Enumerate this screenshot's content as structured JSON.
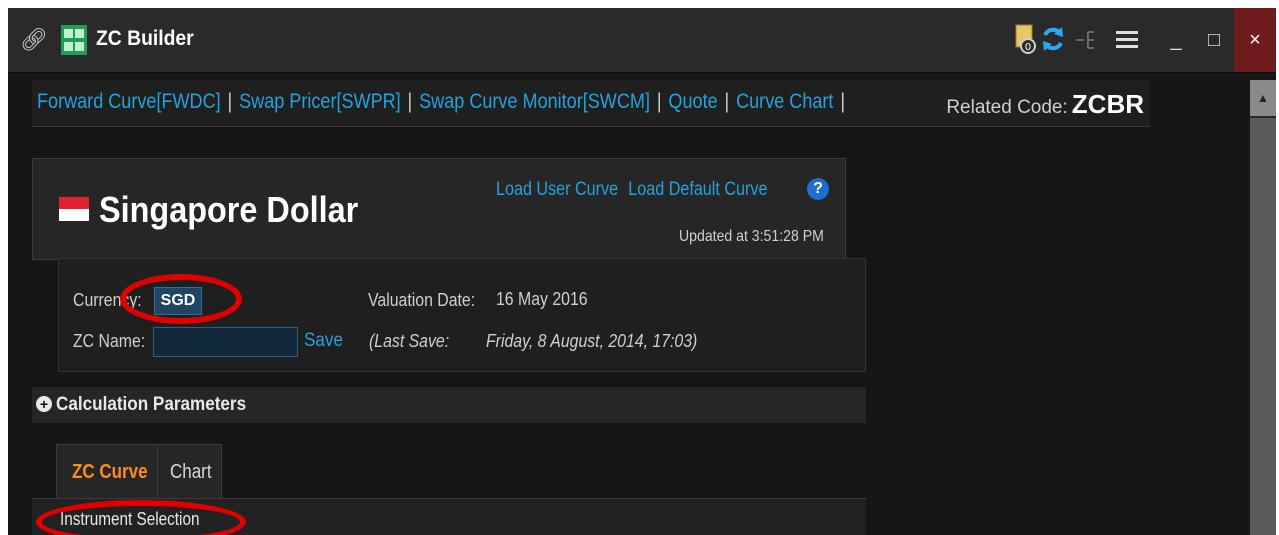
{
  "window": {
    "title": "ZC Builder",
    "minimize": "_",
    "maximize": "□",
    "close": "×"
  },
  "nav": {
    "links": [
      "Forward Curve[FWDC]",
      "Swap Pricer[SWPR]",
      "Swap Curve Monitor[SWCM]",
      "Quote",
      "Curve Chart"
    ],
    "separator": "|",
    "related_label": "Related Code:",
    "related_code": "ZCBR"
  },
  "header": {
    "currency_name": "Singapore Dollar",
    "load_user_curve": "Load User Curve",
    "load_default_curve": "Load Default Curve",
    "help": "?",
    "updated": "Updated at 3:51:28 PM"
  },
  "details": {
    "currency_label": "Currency:",
    "currency_value": "SGD",
    "valuation_label": "Valuation Date:",
    "valuation_value": "16 May 2016",
    "zc_name_label": "ZC Name:",
    "zc_name_value": "",
    "save_label": "Save",
    "last_save_label": "(Last Save:",
    "last_save_value": "Friday, 8 August, 2014, 17:03)"
  },
  "calc": {
    "toggle": "+",
    "label": "Calculation Parameters"
  },
  "tabs": [
    {
      "label": "ZC Curve",
      "active": true
    },
    {
      "label": "Chart",
      "active": false
    }
  ],
  "instrument_selection": "Instrument Selection",
  "colors": {
    "link": "#23a3dd",
    "active_tab": "#ff8c1a",
    "annotation": "#e00000",
    "close_button": "#6e1c1c"
  }
}
